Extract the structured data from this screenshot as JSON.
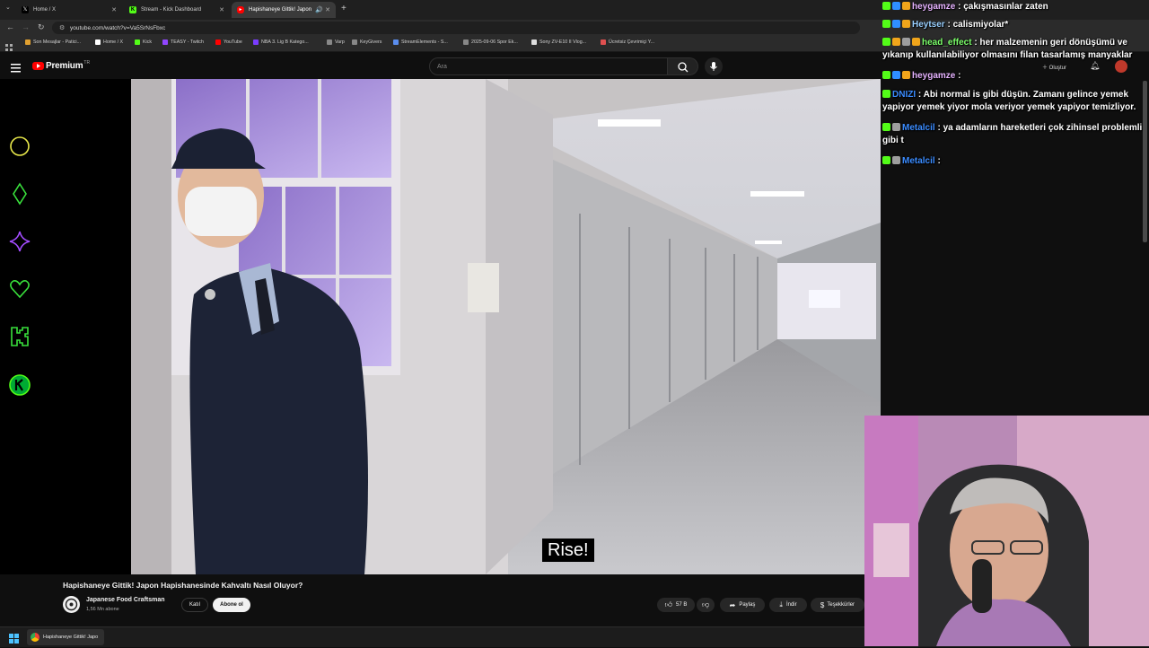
{
  "browser": {
    "tabs": [
      {
        "label": "Home / X",
        "icon": "x-logo-icon"
      },
      {
        "label": "Stream - Kick Dashboard",
        "icon": "kick-logo-icon"
      },
      {
        "label": "Hapishaneye Gittik! Japon",
        "icon": "youtube-logo-icon"
      }
    ],
    "new_tab": "+",
    "url": "youtube.com/watch?v=Va5SrNsFbxc",
    "bookmarks": [
      {
        "label": "Son Mesajlar - Patici...",
        "color": "#e0a030"
      },
      {
        "label": "Home / X",
        "color": "#ffffff"
      },
      {
        "label": "Kick",
        "color": "#53fc18"
      },
      {
        "label": "TEASY - Twitch",
        "color": "#9146ff"
      },
      {
        "label": "YouTube",
        "color": "#ff0000"
      },
      {
        "label": "NBA 3. Lig B Katego...",
        "color": "#7a3cff"
      },
      {
        "label": "Varp",
        "color": "#888888"
      },
      {
        "label": "KeyGivers",
        "color": "#888888"
      },
      {
        "label": "StreamElements - S...",
        "color": "#5a8dee"
      },
      {
        "label": "2025-09-06 Spor Ek...",
        "color": "#888888"
      },
      {
        "label": "Sony ZV-E10 II Vlog...",
        "color": "#dddddd"
      },
      {
        "label": "Ücretsiz Çevrimiçi Y...",
        "color": "#e05050"
      }
    ]
  },
  "youtube": {
    "logo_text": "Premium",
    "logo_sup": "TR",
    "search_placeholder": "Ara",
    "create_label": "Oluştur",
    "subtitle": "Rise!",
    "video_title": "Hapishaneye Gittik! Japon Hapishanesinde Kahvaltı Nasıl Oluyor?",
    "channel_name": "Japanese Food Craftsman",
    "channel_subs": "1,56 Mn abone",
    "join_label": "Katıl",
    "subscribe_label": "Abone ol",
    "like_count": "57 B",
    "share_label": "Paylaş",
    "download_label": "İndir",
    "thanks_label": "Teşekkürler"
  },
  "taskbar": {
    "active_window": "Hapishaneye Gittik! Japo"
  },
  "chat": [
    {
      "user": "heygamze",
      "sep": " : ",
      "message": "çakışmasınlar zaten",
      "color": "#e6b3ff",
      "badges": [
        "kick",
        "blue",
        "gold"
      ]
    },
    {
      "user": "Heytser",
      "sep": " : ",
      "message": "calismiyolar*",
      "color": "#9ad0ff",
      "badges": [
        "kick",
        "blue",
        "gold"
      ]
    },
    {
      "user": "head_effect",
      "sep": " : ",
      "message": "her malzemenin geri dönüşümü ve yıkanıp kullanılabiliyor olmasını filan tasarlamış manyaklar",
      "color": "#7cff6b",
      "badges": [
        "kick",
        "gold",
        "gray",
        "gold"
      ]
    },
    {
      "user": "heygamze",
      "sep": " : ",
      "message": "",
      "color": "#e6b3ff",
      "badges": [
        "kick",
        "blue",
        "gold"
      ]
    },
    {
      "user": "DNIZI",
      "sep": " : ",
      "message": "Abi normal is gibi düşün. Zamanı gelince yemek yapiyor yemek yiyor mola veriyor yemek yapiyor temizliyor.",
      "color": "#3b8cff",
      "badges": [
        "kick"
      ]
    },
    {
      "user": "Metalcil",
      "sep": " : ",
      "message": "ya adamların hareketleri çok zihinsel problemli gibi t",
      "color": "#3b8cff",
      "badges": [
        "kick",
        "gray"
      ]
    },
    {
      "user": "Metalcil",
      "sep": " : ",
      "message": "",
      "color": "#3b8cff",
      "badges": [
        "kick",
        "gray"
      ]
    }
  ]
}
